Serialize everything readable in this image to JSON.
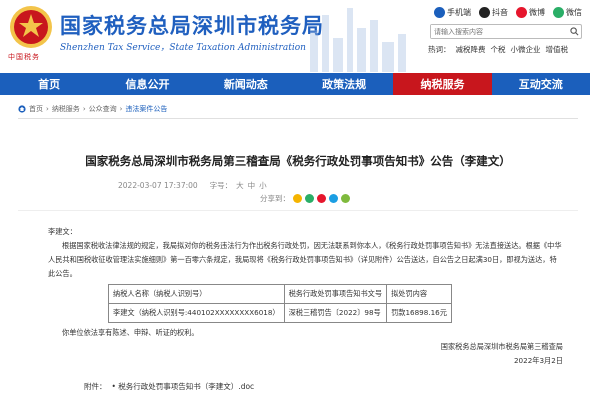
{
  "header": {
    "title": "国家税务总局深圳市税务局",
    "subtitle": "Shenzhen Tax Service，State Taxation Administration",
    "brand": "中国税务",
    "quick_links": [
      {
        "label": "手机端",
        "icon": "mobile-icon"
      },
      {
        "label": "抖音",
        "icon": "douyin-icon"
      },
      {
        "label": "微博",
        "icon": "weibo-icon"
      },
      {
        "label": "微信",
        "icon": "wechat-icon"
      }
    ],
    "search": {
      "placeholder": "请输入搜索内容",
      "icon": "search-icon"
    },
    "hot_words": [
      "热词：",
      "减税降费",
      "个税",
      "小微企业",
      "增值税"
    ]
  },
  "nav": [
    {
      "label": "首页",
      "active": false
    },
    {
      "label": "信息公开",
      "active": false
    },
    {
      "label": "新闻动态",
      "active": false
    },
    {
      "label": "政策法规",
      "active": false
    },
    {
      "label": "纳税服务",
      "active": true
    },
    {
      "label": "互动交流",
      "active": false
    }
  ],
  "breadcrumb": [
    "首页",
    "纳税服务",
    "公众查询",
    "违法案件公告"
  ],
  "article": {
    "title": "国家税务总局深圳市税务局第三稽查局《税务行政处罚事项告知书》公告（李建文）",
    "date": "2022-03-07 17:37:00",
    "size_label": "字号：",
    "sizes": [
      "大",
      "中",
      "小"
    ],
    "share_label": "分享到：",
    "salutation": "李建文：",
    "para1": "根据国家税收法律法规的规定，我局拟对你的税务违法行为作出税务行政处罚，因无法联系到你本人，《税务行政处罚事项告知书》无法直接送达。根据《中华人民共和国税收征收管理法实施细则》第一百零六条规定，我局现将《税务行政处罚事项告知书》（详见附件）公告送达，自公告之日起满30日，即视为送达，特此公告。",
    "table": {
      "headers": [
        "纳税人名称（纳税人识别号）",
        "税务行政处罚事项告知书文号",
        "拟处罚内容"
      ],
      "rows": [
        [
          "李建文（纳税人识别号:440102XXXXXXXX6018）",
          "深税三稽罚告〔2022〕98号",
          "罚款16898.16元"
        ]
      ]
    },
    "para2": "你单位依法享有陈述、申辩、听证的权利。",
    "signature": "国家税务总局深圳市税务局第三稽查局",
    "sign_date": "2022年3月2日",
    "attachment_label": "附件：",
    "attachment": "• 税务行政处罚事项告知书（李建文）.doc"
  },
  "colors": {
    "primary": "#1b5fbc",
    "accent": "#c8161d"
  }
}
